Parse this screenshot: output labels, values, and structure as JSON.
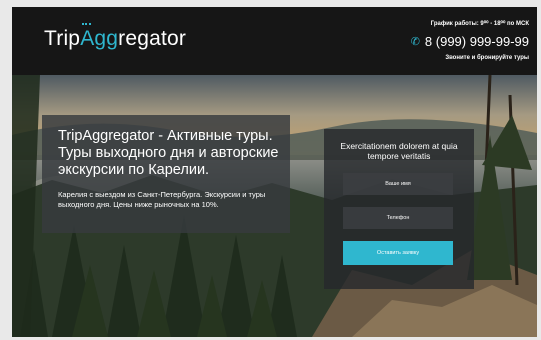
{
  "header": {
    "logo_prefix": "Trip",
    "logo_accent": "Agg",
    "logo_suffix": "regator",
    "hours_text": "График работы: 9⁰⁰ - 18⁰⁰ по МСК",
    "phone": "8 (999) 999-99-99",
    "phone_icon": "phone-icon",
    "cta_line": "Звоните и бронируйте туры"
  },
  "hero": {
    "headline": "TripAggregator - Активные туры. Туры выходного дня и авторские экскурсии по Карелии.",
    "subtext": "Карелия с выездом из Санкт-Петербурга. Экскурсии и туры выходного дня. Цены ниже рыночных на 10%."
  },
  "form": {
    "title": "Exercitationem dolorem at quia tempore veritatis",
    "name_placeholder": "Ваше имя",
    "phone_placeholder": "Телефон",
    "submit_label": "Оставить заявку"
  },
  "colors": {
    "accent": "#2fb7cf",
    "header_bg": "#161616"
  }
}
